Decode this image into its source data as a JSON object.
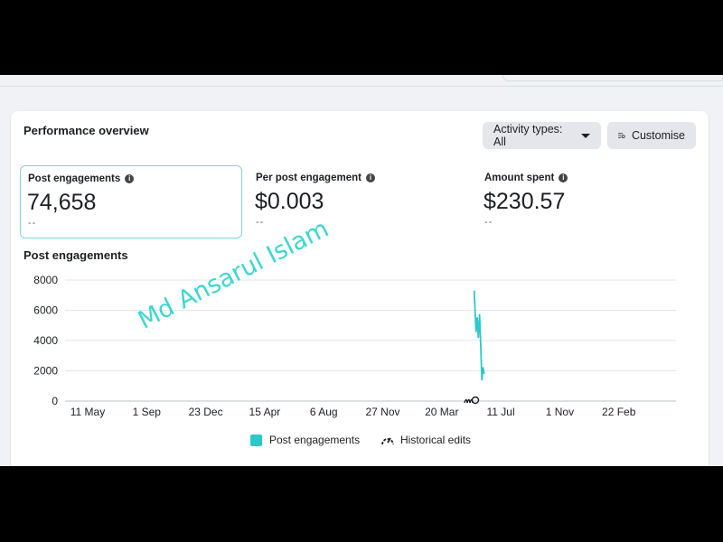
{
  "card": {
    "title": "Performance overview",
    "activity_button": "Activity types: All",
    "customise_button": "Customise"
  },
  "metrics": [
    {
      "label": "Post engagements",
      "value": "74,658",
      "sub": "--",
      "selected": true
    },
    {
      "label": "Per post engagement",
      "value": "$0.003",
      "sub": "--",
      "selected": false
    },
    {
      "label": "Amount spent",
      "value": "$230.57",
      "sub": "--",
      "selected": false
    }
  ],
  "chart": {
    "title": "Post engagements",
    "legend_series": "Post engagements",
    "legend_edits": "Historical edits"
  },
  "chart_data": {
    "type": "line",
    "y_ticks": [
      "8000",
      "6000",
      "4000",
      "2000",
      "0"
    ],
    "ylim": [
      0,
      8000
    ],
    "x_ticks": [
      "11 May",
      "1 Sep",
      "23 Dec",
      "15 Apr",
      "6 Aug",
      "27 Nov",
      "20 Mar",
      "11 Jul",
      "1 Nov",
      "22 Feb"
    ],
    "series": [
      {
        "name": "Post engagements",
        "color": "#2ec7cb",
        "points": [
          [
            6.55,
            7300
          ],
          [
            6.58,
            4600
          ],
          [
            6.6,
            5500
          ],
          [
            6.62,
            4200
          ],
          [
            6.64,
            5700
          ],
          [
            6.66,
            3800
          ],
          [
            6.68,
            1400
          ],
          [
            6.7,
            2200
          ],
          [
            6.72,
            1800
          ]
        ]
      }
    ]
  },
  "watermark": "Md Ansarul Islam",
  "colors": {
    "accent": "#2ec7cb",
    "selected_border": "#7fd3dd",
    "watermark": "#3dd6cf"
  }
}
